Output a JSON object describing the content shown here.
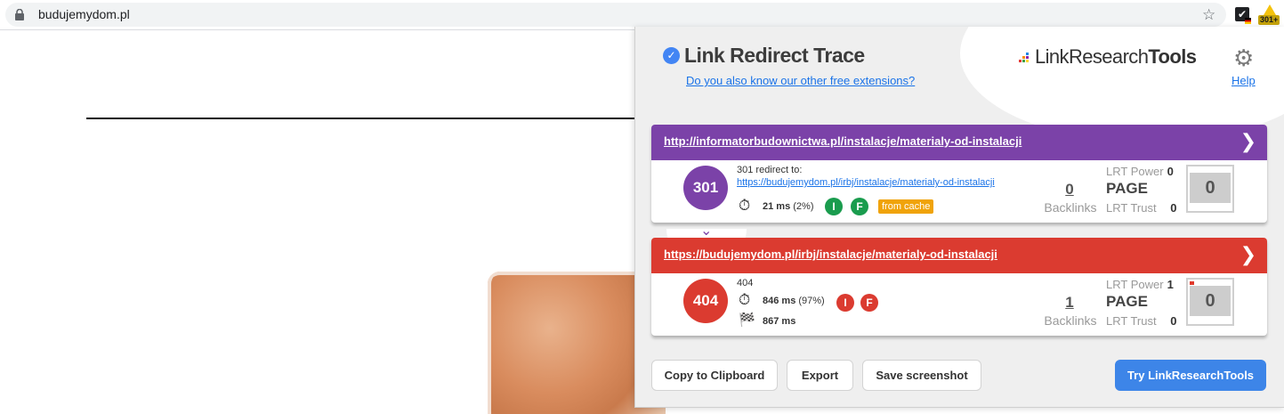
{
  "browser": {
    "url": "budujemydom.pl",
    "extension_badge": "301+"
  },
  "popup": {
    "title": "Link Redirect Trace",
    "subtitle_link": "Do you also know our other free extensions?",
    "brand_logo": {
      "light": "Link",
      "mid": "Research",
      "bold": "Tools"
    },
    "help": "Help",
    "cards": [
      {
        "url": "http://informatorbudownictwa.pl/instalacje/materialy-od-instalacji",
        "status": "301",
        "color": "#7b42a8",
        "line1": "301 redirect to:",
        "redirect_url": "https://budujemydom.pl/irbj/instalacje/materialy-od-instalacji",
        "time": "21 ms",
        "time_pct": "(2%)",
        "pill_i": "I",
        "pill_f": "F",
        "pill_color": "#1a9c4e",
        "cache": "from cache",
        "backlinks": "0",
        "backlinks_label": "Backlinks",
        "lrt_power_label": "LRT Power",
        "lrt_power": "0",
        "page_label": "PAGE",
        "lrt_trust_label": "LRT Trust",
        "lrt_trust": "0",
        "score": "0"
      },
      {
        "url": "https://budujemydom.pl/irbj/instalacje/materialy-od-instalacji",
        "status": "404",
        "color": "#db3b30",
        "line1": "404",
        "time": "846 ms",
        "time_pct": "(97%)",
        "total_time": "867 ms",
        "pill_i": "I",
        "pill_f": "F",
        "pill_color": "#db3b30",
        "backlinks": "1",
        "backlinks_label": "Backlinks",
        "lrt_power_label": "LRT Power",
        "lrt_power": "1",
        "page_label": "PAGE",
        "lrt_trust_label": "LRT Trust",
        "lrt_trust": "0",
        "score": "0"
      }
    ],
    "buttons": {
      "copy": "Copy to Clipboard",
      "export": "Export",
      "screenshot": "Save screenshot",
      "try": "Try LinkResearchTools"
    }
  }
}
